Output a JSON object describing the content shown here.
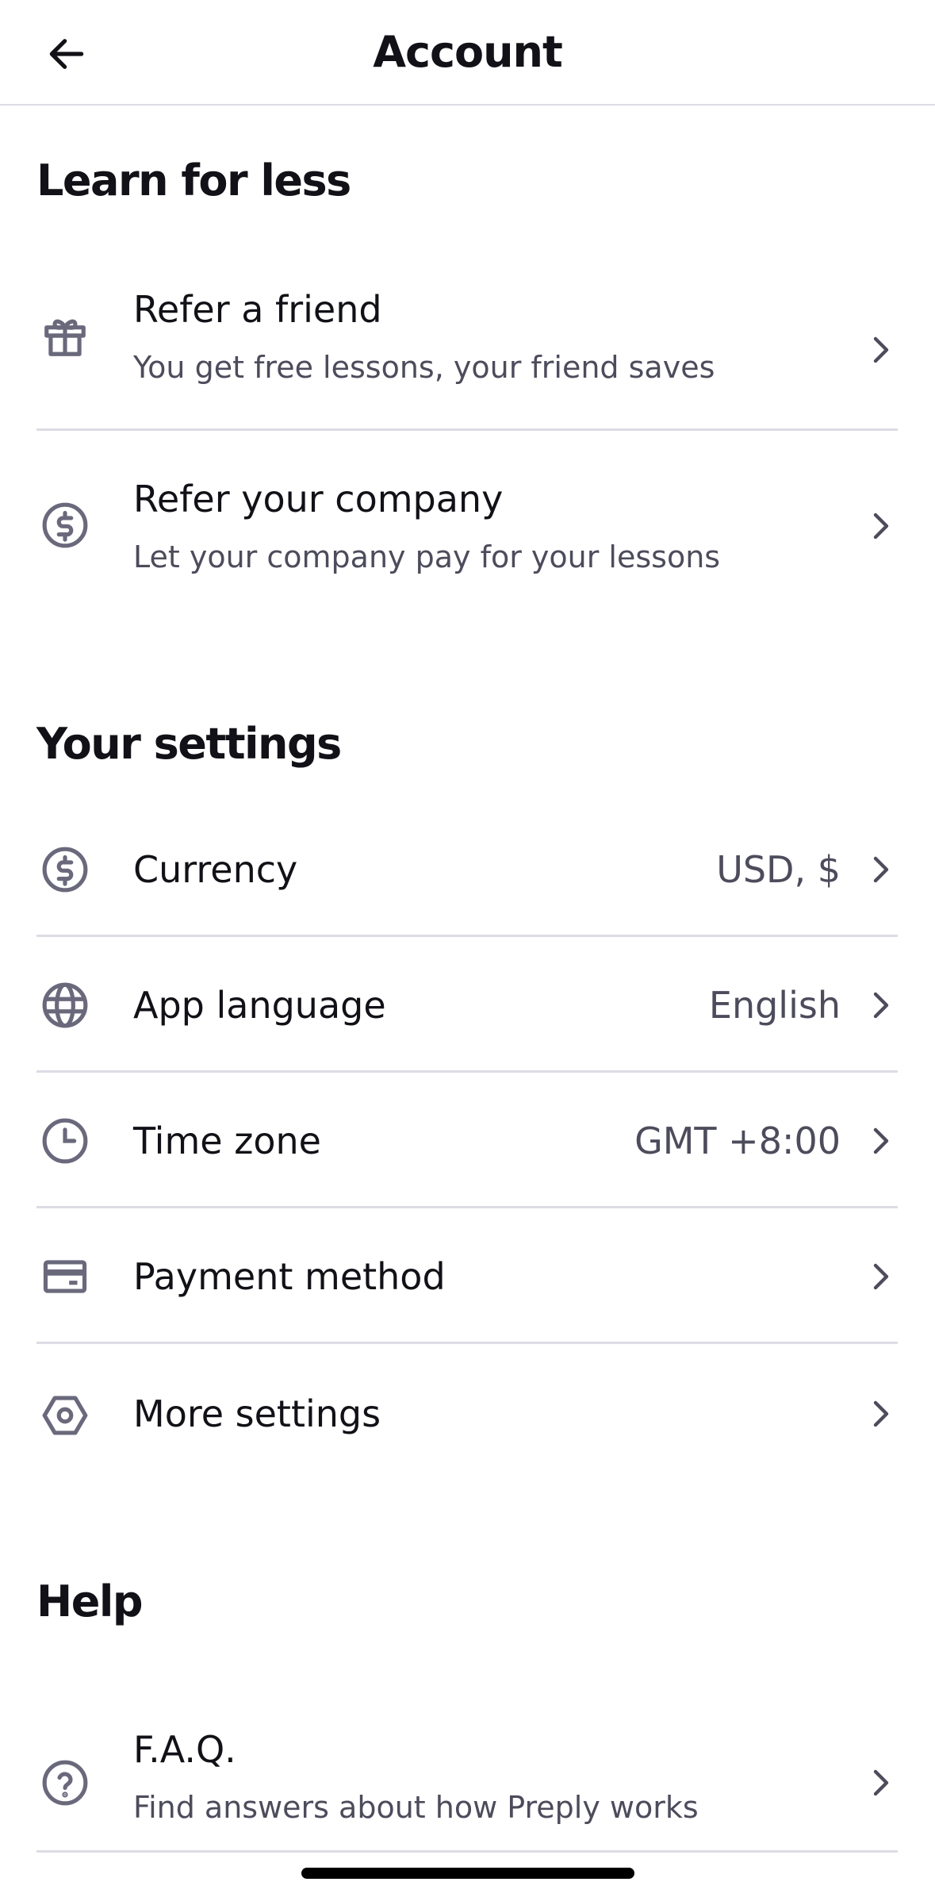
{
  "header": {
    "title": "Account"
  },
  "sections": {
    "learn": {
      "title": "Learn for less",
      "refer_friend": {
        "label": "Refer a friend",
        "subtitle": "You get free lessons, your friend saves"
      },
      "refer_company": {
        "label": "Refer your company",
        "subtitle": "Let your company pay for your lessons"
      }
    },
    "settings": {
      "title": "Your settings",
      "currency": {
        "label": "Currency",
        "value": "USD, $"
      },
      "language": {
        "label": "App language",
        "value": "English"
      },
      "timezone": {
        "label": "Time zone",
        "value": "GMT +8:00"
      },
      "payment": {
        "label": "Payment method"
      },
      "more": {
        "label": "More settings"
      }
    },
    "help": {
      "title": "Help",
      "faq": {
        "label": "F.A.Q.",
        "subtitle": "Find answers about how Preply works"
      }
    }
  },
  "colors": {
    "text": "#121117",
    "secondary_text": "#4d4c5c",
    "icon": "#6a697c",
    "divider": "#dcdce5",
    "background": "#ffffff"
  }
}
